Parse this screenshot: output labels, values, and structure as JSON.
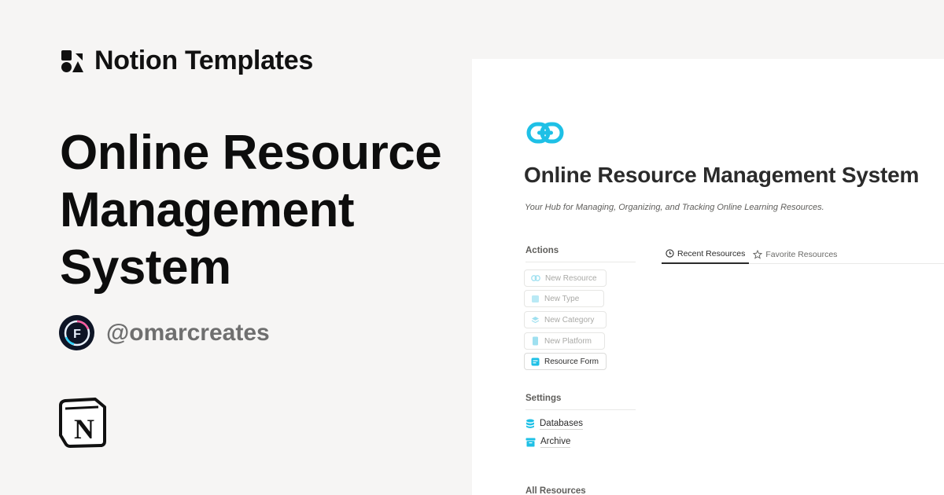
{
  "brand": {
    "name": "Notion Templates"
  },
  "hero": {
    "title": "Online Resource Management System"
  },
  "author": {
    "handle": "@omarcreates"
  },
  "notion_page": {
    "title": "Online Resource Management System",
    "subtitle": "Your Hub for Managing, Organizing, and Tracking Online Learning Resources.",
    "accent_color": "#1ec0e6",
    "actions": {
      "heading": "Actions",
      "items": [
        {
          "label": "New Resource",
          "icon": "link-icon"
        },
        {
          "label": "New Type",
          "icon": "square-icon"
        },
        {
          "label": "New Category",
          "icon": "layers-icon"
        },
        {
          "label": "New Platform",
          "icon": "phone-icon"
        },
        {
          "label": "Resource Form",
          "icon": "form-icon"
        }
      ]
    },
    "settings": {
      "heading": "Settings",
      "items": [
        {
          "label": "Databases",
          "icon": "database-icon"
        },
        {
          "label": "Archive",
          "icon": "archive-icon"
        }
      ]
    },
    "tabs": [
      {
        "label": "Recent Resources",
        "icon": "clock-icon",
        "active": true
      },
      {
        "label": "Favorite Resources",
        "icon": "star-icon",
        "active": false
      }
    ],
    "all_resources": {
      "heading": "All Resources"
    }
  }
}
